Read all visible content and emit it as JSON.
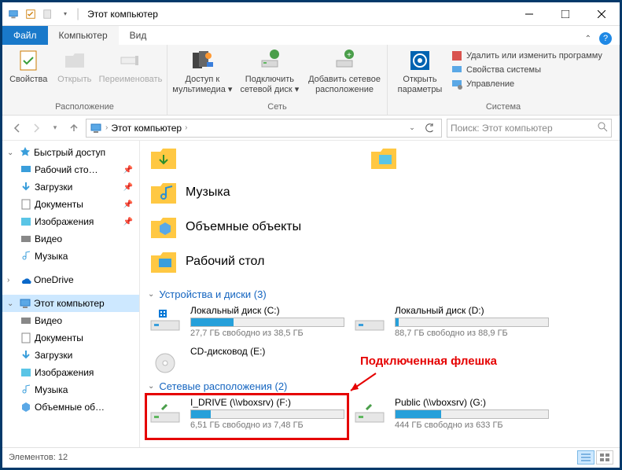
{
  "title": "Этот компьютер",
  "tabs": {
    "file": "Файл",
    "computer": "Компьютер",
    "view": "Вид"
  },
  "ribbon": {
    "group1": {
      "label": "Расположение",
      "props": "Свойства",
      "open": "Открыть",
      "rename": "Переименовать"
    },
    "group2": {
      "label": "Сеть",
      "media": "Доступ к мультимедиа",
      "mapdrive": "Подключить сетевой диск",
      "addnet": "Добавить сетевое расположение"
    },
    "group3": {
      "label": "Система",
      "settings": "Открыть параметры",
      "uninstall": "Удалить или изменить программу",
      "sysprops": "Свойства системы",
      "manage": "Управление"
    }
  },
  "addr": {
    "location": "Этот компьютер",
    "search_placeholder": "Поиск: Этот компьютер"
  },
  "sidebar": {
    "quick": "Быстрый доступ",
    "desktop": "Рабочий сто…",
    "downloads": "Загрузки",
    "documents": "Документы",
    "pictures": "Изображения",
    "video": "Видео",
    "music": "Музыка",
    "onedrive": "OneDrive",
    "thispc": "Этот компьютер",
    "video2": "Видео",
    "documents2": "Документы",
    "downloads2": "Загрузки",
    "pictures2": "Изображения",
    "music2": "Музыка",
    "volumes": "Объемные об…"
  },
  "folders": {
    "music": "Музыка",
    "desktop": "Рабочий стол",
    "objects": "Объемные объекты"
  },
  "groups": {
    "devices": "Устройства и диски (3)",
    "network": "Сетевые расположения (2)"
  },
  "drives": {
    "c": {
      "name": "Локальный диск (C:)",
      "free": "27,7 ГБ свободно из 38,5 ГБ",
      "fill": 28
    },
    "d": {
      "name": "Локальный диск (D:)",
      "free": "88,7 ГБ свободно из 88,9 ГБ",
      "fill": 2
    },
    "e": {
      "name": "CD-дисковод (E:)"
    },
    "f": {
      "name": "I_DRIVE (\\\\vboxsrv) (F:)",
      "free": "6,51 ГБ свободно из 7,48 ГБ",
      "fill": 13
    },
    "g": {
      "name": "Public (\\\\vboxsrv) (G:)",
      "free": "444 ГБ свободно из 633 ГБ",
      "fill": 30
    }
  },
  "annotation": "Подключенная флешка",
  "status": {
    "items": "Элементов: 12"
  }
}
